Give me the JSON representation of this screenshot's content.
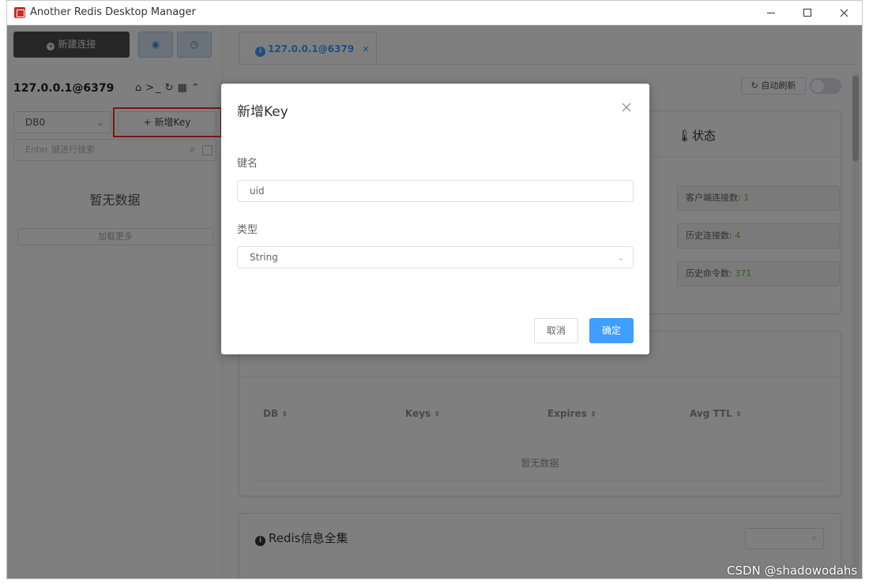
{
  "window": {
    "title": "Another Redis Desktop Manager"
  },
  "sidebar": {
    "new_connection_label": "新建连接",
    "connection_name": "127.0.0.1@6379",
    "db_select_value": "DB0",
    "new_key_label": "+ 新增Key",
    "search_placeholder": "Enter 键进行搜索",
    "empty_text": "暂无数据",
    "load_more_label": "加载更多"
  },
  "main": {
    "tab_label": "127.0.0.1@6379",
    "auto_refresh_label": "自动刷新",
    "status_title": "状态",
    "stats": [
      {
        "label": "客户端连接数: ",
        "value": "1"
      },
      {
        "label": "历史连接数: ",
        "value": "4"
      },
      {
        "label": "历史命令数: ",
        "value": "371"
      }
    ],
    "keyspace_headers": [
      "DB",
      "Keys",
      "Expires",
      "Avg TTL"
    ],
    "keyspace_empty": "暂无数据",
    "info_title": "Redis信息全集"
  },
  "modal": {
    "title": "新增Key",
    "key_name_label": "键名",
    "key_name_value": "uid",
    "type_label": "类型",
    "type_value": "String",
    "cancel_label": "取消",
    "ok_label": "确定"
  },
  "watermark": "CSDN @shadowodahs",
  "colors": {
    "accent": "#409eff",
    "highlight": "#e8302a",
    "success": "#67c23a"
  }
}
